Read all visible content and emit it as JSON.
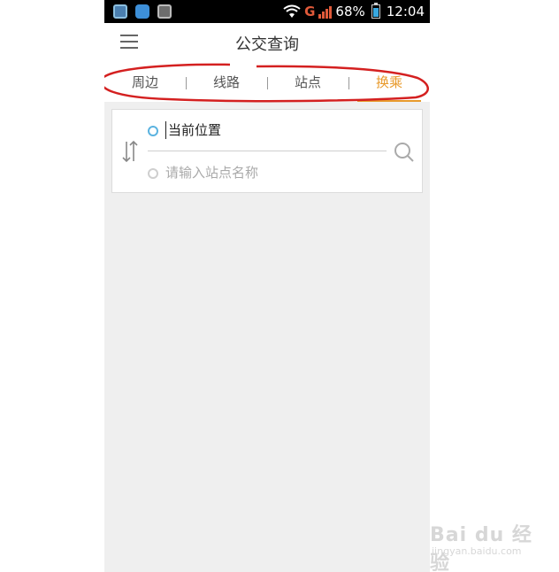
{
  "status_bar": {
    "network": "G",
    "battery": "68%",
    "time": "12:04"
  },
  "header": {
    "title": "公交查询",
    "menu_icon": "hamburger-menu-icon"
  },
  "tabs": [
    {
      "label": "周边",
      "active": false
    },
    {
      "label": "线路",
      "active": false
    },
    {
      "label": "站点",
      "active": false
    },
    {
      "label": "换乘",
      "active": true
    }
  ],
  "route": {
    "start_value": "当前位置",
    "end_placeholder": "请输入站点名称",
    "swap_icon": "swap-arrows-icon",
    "search_icon": "search-icon"
  },
  "colors": {
    "accent": "#e89a2c",
    "start_dot": "#5bb3e0",
    "annotation": "#d42020"
  },
  "watermark": {
    "logo": "Bai du 经验",
    "url": "jingyan.baidu.com"
  }
}
